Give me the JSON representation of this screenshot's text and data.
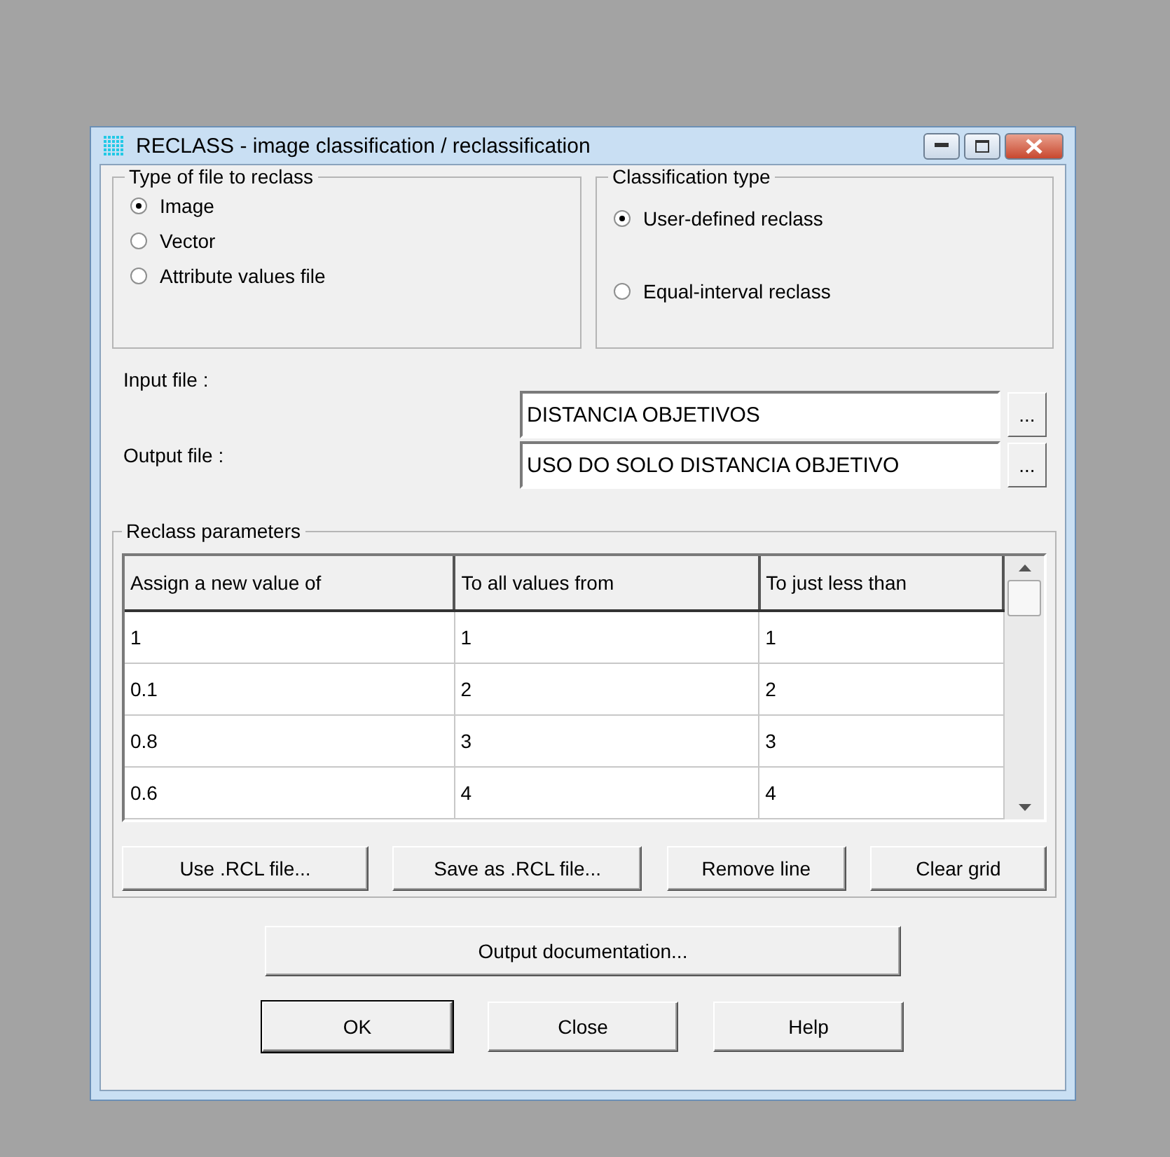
{
  "window": {
    "title": "RECLASS - image classification / reclassification"
  },
  "file_type": {
    "legend": "Type of file to reclass",
    "options": [
      {
        "label": "Image",
        "selected": true
      },
      {
        "label": "Vector",
        "selected": false
      },
      {
        "label": "Attribute values file",
        "selected": false
      }
    ]
  },
  "classification_type": {
    "legend": "Classification type",
    "options": [
      {
        "label": "User-defined reclass",
        "selected": true
      },
      {
        "label": "Equal-interval reclass",
        "selected": false
      }
    ]
  },
  "files": [
    {
      "label": "Input file :",
      "value": "DISTANCIA OBJETIVOS",
      "browse": "..."
    },
    {
      "label": "Output file :",
      "value": "USO DO SOLO DISTANCIA OBJETIVO",
      "browse": "..."
    }
  ],
  "reclass_parameters": {
    "legend": "Reclass parameters",
    "table": {
      "columns": [
        "Assign a new value of",
        "To all values from",
        "To just less than"
      ],
      "rows": [
        [
          "1",
          "1",
          "1"
        ],
        [
          "0.1",
          "2",
          "2"
        ],
        [
          "0.8",
          "3",
          "3"
        ],
        [
          "0.6",
          "4",
          "4"
        ]
      ]
    },
    "buttons": [
      "Use .RCL file...",
      "Save as .RCL file...",
      "Remove line",
      "Clear grid"
    ]
  },
  "documentation_button": "Output documentation...",
  "buttons": [
    {
      "label": "OK",
      "default": true
    },
    {
      "label": "Close",
      "default": false
    },
    {
      "label": "Help",
      "default": false
    }
  ]
}
